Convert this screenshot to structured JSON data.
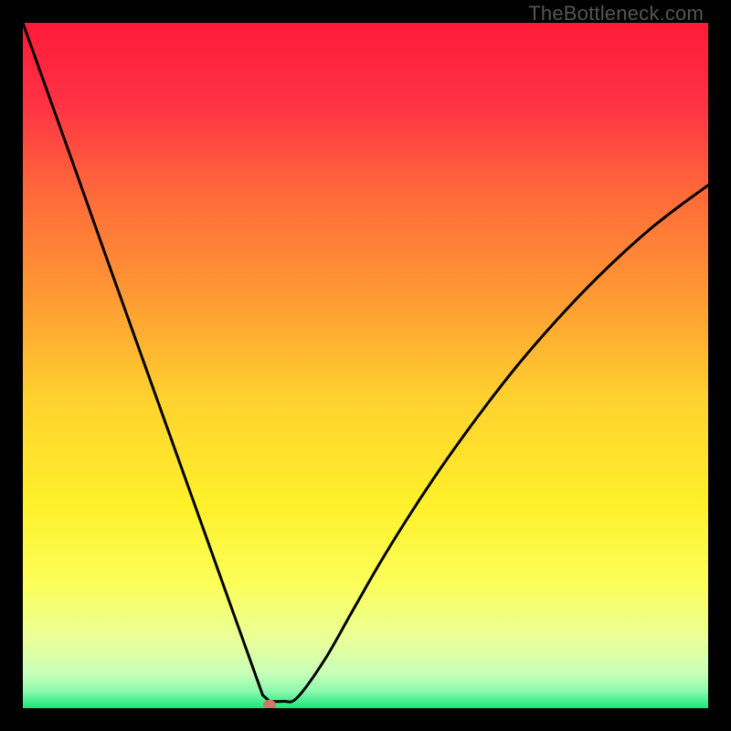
{
  "watermark": "TheBottleneck.com",
  "chart_data": {
    "type": "line",
    "title": "",
    "xlabel": "",
    "ylabel": "",
    "xlim": [
      0,
      100
    ],
    "ylim": [
      0,
      100
    ],
    "series": [
      {
        "name": "curve",
        "x": [
          0,
          4,
          8,
          12,
          16,
          20,
          24,
          28,
          30,
          32,
          33,
          34,
          35,
          36,
          38,
          40,
          44,
          48,
          52,
          56,
          60,
          64,
          68,
          72,
          76,
          80,
          84,
          88,
          92,
          96,
          100
        ],
        "y": [
          100,
          88.8,
          77.6,
          66.3,
          55.1,
          43.9,
          32.7,
          21.5,
          15.9,
          10.3,
          7.5,
          4.7,
          1.9,
          1,
          1,
          1.5,
          7.0,
          14.0,
          21.0,
          27.5,
          33.6,
          39.3,
          44.7,
          49.8,
          54.5,
          58.9,
          63.0,
          66.8,
          70.3,
          73.4,
          76.3
        ]
      }
    ],
    "marker": {
      "x": 36,
      "y": 0.5
    },
    "gradient_stops": [
      {
        "offset": 0.0,
        "color": "#ff1a3a"
      },
      {
        "offset": 0.12,
        "color": "#ff3344"
      },
      {
        "offset": 0.25,
        "color": "#ff6a3a"
      },
      {
        "offset": 0.4,
        "color": "#ff9a33"
      },
      {
        "offset": 0.55,
        "color": "#ffd22f"
      },
      {
        "offset": 0.7,
        "color": "#fff02a"
      },
      {
        "offset": 0.82,
        "color": "#fbff5a"
      },
      {
        "offset": 0.9,
        "color": "#eaff9a"
      },
      {
        "offset": 0.95,
        "color": "#c7ffb8"
      },
      {
        "offset": 0.975,
        "color": "#8cf9ad"
      },
      {
        "offset": 1.0,
        "color": "#17e87a"
      }
    ]
  }
}
